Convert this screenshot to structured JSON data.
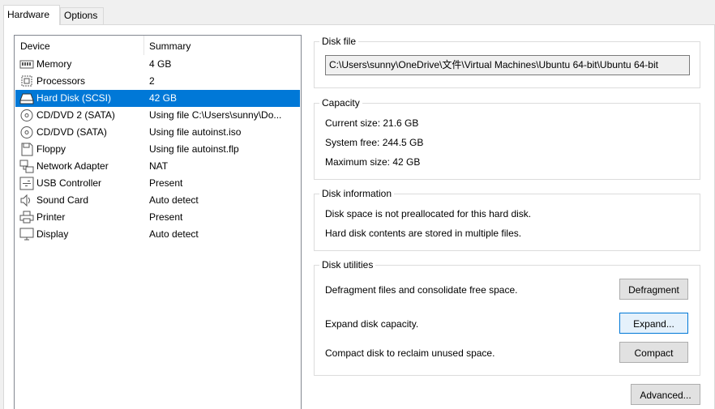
{
  "tabs": [
    {
      "label": "Hardware",
      "active": true
    },
    {
      "label": "Options",
      "active": false
    }
  ],
  "device_list": {
    "columns": [
      "Device",
      "Summary"
    ],
    "selected_index": 2,
    "rows": [
      {
        "device": "Memory",
        "summary": "4 GB",
        "icon": "memory-icon"
      },
      {
        "device": "Processors",
        "summary": "2",
        "icon": "processor-icon"
      },
      {
        "device": "Hard Disk (SCSI)",
        "summary": "42 GB",
        "icon": "hard-disk-icon"
      },
      {
        "device": "CD/DVD 2 (SATA)",
        "summary": "Using file C:\\Users\\sunny\\Do...",
        "icon": "cd-dvd-icon"
      },
      {
        "device": "CD/DVD (SATA)",
        "summary": "Using file autoinst.iso",
        "icon": "cd-dvd-icon"
      },
      {
        "device": "Floppy",
        "summary": "Using file autoinst.flp",
        "icon": "floppy-icon"
      },
      {
        "device": "Network Adapter",
        "summary": "NAT",
        "icon": "network-adapter-icon"
      },
      {
        "device": "USB Controller",
        "summary": "Present",
        "icon": "usb-icon"
      },
      {
        "device": "Sound Card",
        "summary": "Auto detect",
        "icon": "speaker-icon"
      },
      {
        "device": "Printer",
        "summary": "Present",
        "icon": "printer-icon"
      },
      {
        "device": "Display",
        "summary": "Auto detect",
        "icon": "monitor-icon"
      }
    ]
  },
  "disk_file": {
    "title": "Disk file",
    "path": "C:\\Users\\sunny\\OneDrive\\文件\\Virtual Machines\\Ubuntu 64-bit\\Ubuntu 64-bit"
  },
  "capacity": {
    "title": "Capacity",
    "current": "Current size: 21.6 GB",
    "free": "System free: 244.5 GB",
    "maximum": "Maximum size: 42 GB"
  },
  "disk_information": {
    "title": "Disk information",
    "line1": "Disk space is not preallocated for this hard disk.",
    "line2": "Hard disk contents are stored in multiple files."
  },
  "disk_utilities": {
    "title": "Disk utilities",
    "defrag_text": "Defragment files and consolidate free space.",
    "defrag_button": "Defragment",
    "expand_text": "Expand disk capacity.",
    "expand_button": "Expand...",
    "compact_text": "Compact disk to reclaim unused space.",
    "compact_button": "Compact"
  },
  "advanced_button": "Advanced...",
  "colors": {
    "selection": "#0078d7",
    "window": "#f0f0f0",
    "panel": "#ffffff"
  }
}
